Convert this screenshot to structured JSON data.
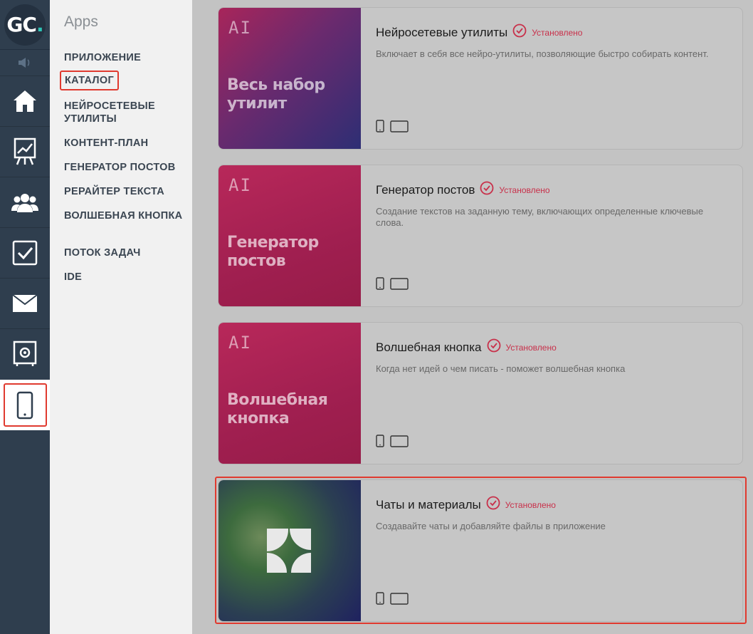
{
  "logo": {
    "text_main": "GC",
    "text_dot": "."
  },
  "rail": {
    "items": [
      {
        "icon": "home-icon"
      },
      {
        "icon": "chart-icon"
      },
      {
        "icon": "users-icon"
      },
      {
        "icon": "tasks-icon"
      },
      {
        "icon": "mail-icon"
      },
      {
        "icon": "safe-icon"
      },
      {
        "icon": "phone-icon"
      }
    ]
  },
  "menu": {
    "title": "Apps",
    "items": [
      {
        "label": "ПРИЛОЖЕНИЕ"
      },
      {
        "label": "КАТАЛОГ"
      },
      {
        "label": "НЕЙРОСЕТЕВЫЕ УТИЛИТЫ"
      },
      {
        "label": "КОНТЕНТ-ПЛАН"
      },
      {
        "label": "ГЕНЕРАТОР ПОСТОВ"
      },
      {
        "label": "РЕРАЙТЕР ТЕКСТА"
      },
      {
        "label": "ВОЛШЕБНАЯ КНОПКА"
      },
      {
        "label": "ПОТОК ЗАДАЧ"
      },
      {
        "label": "IDE"
      }
    ]
  },
  "cards": [
    {
      "title": "Нейросетевые утилиты",
      "status": "Установлено",
      "description": "Включает в себя все нейро-утилиты, позволяющие быстро собирать контент.",
      "thumb_badge": "AI",
      "thumb_text": "Весь набор утилит"
    },
    {
      "title": "Генератор постов",
      "status": "Установлено",
      "description": "Создание текстов на заданную тему, включающих определенные ключевые слова.",
      "thumb_badge": "AI",
      "thumb_text": "Генератор постов"
    },
    {
      "title": "Волшебная кнопка",
      "status": "Установлено",
      "description": "Когда нет идей о чем писать - поможет волшебная кнопка",
      "thumb_badge": "AI",
      "thumb_text": "Волшебная кнопка"
    },
    {
      "title": "Чаты и материалы",
      "status": "Установлено",
      "description": "Создавайте чаты и добавляйте файлы в приложение"
    }
  ],
  "colors": {
    "rail": "#2f3e4e",
    "accent_red": "#e03a2f",
    "status_red": "#c8304a",
    "logo_teal": "#2ec4b6"
  }
}
